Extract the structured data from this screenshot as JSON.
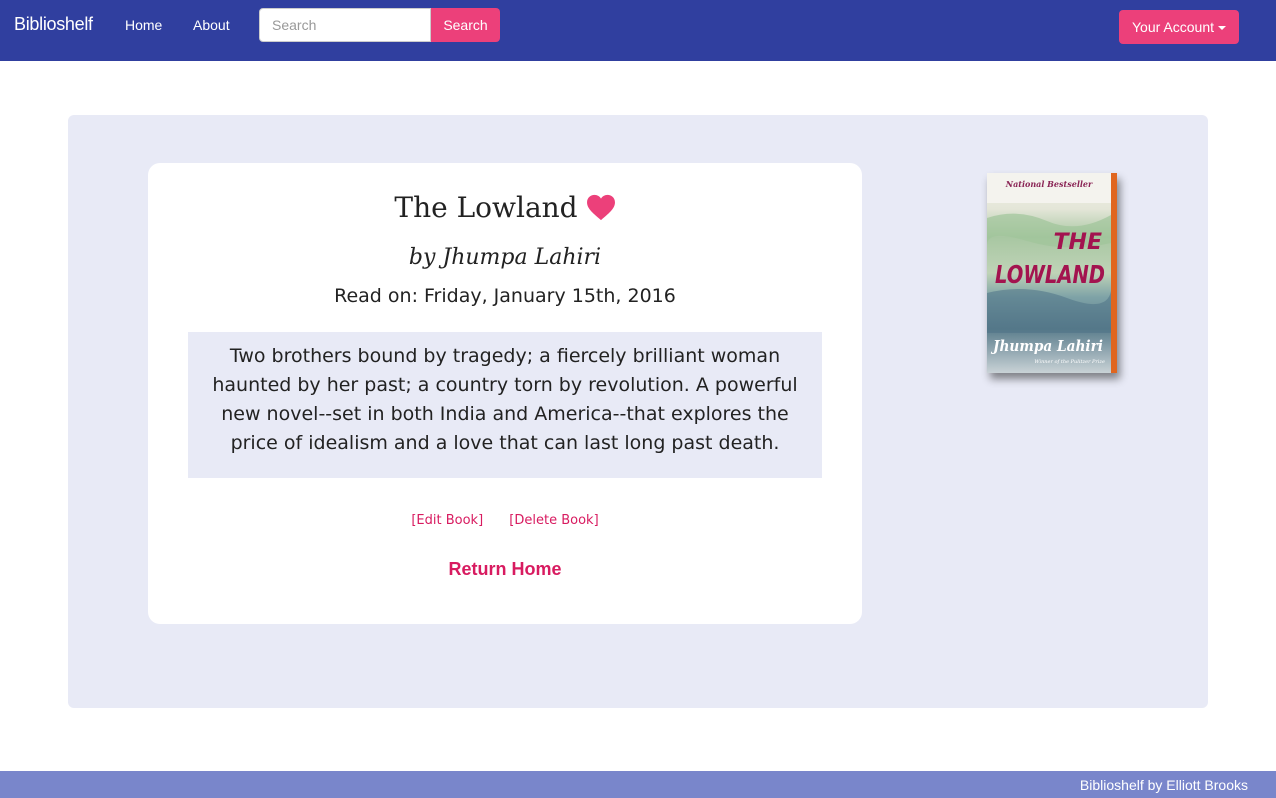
{
  "navbar": {
    "brand": "Biblioshelf",
    "links": [
      {
        "label": "Home"
      },
      {
        "label": "About"
      }
    ],
    "search": {
      "placeholder": "Search",
      "value": "",
      "button_label": "Search"
    },
    "account_label": "Your Account"
  },
  "book": {
    "title": "The Lowland",
    "favorite_icon": "heart-icon",
    "author_line": "by Jhumpa Lahiri",
    "read_on": "Read on: Friday, January 15th, 2016",
    "description": "Two brothers bound by tragedy; a fiercely brilliant woman haunted by her past; a country torn by revolution. A powerful new novel--set in both India and America--that explores the price of idealism and a love that can last long past death.",
    "edit_label": "[Edit Book]",
    "delete_label": "[Delete Book]",
    "return_label": "Return Home",
    "cover": {
      "top_text": "National Bestseller",
      "title_line1": "THE",
      "title_line2": "LOWLAND",
      "author": "Jhumpa Lahiri",
      "subtitle": "Winner of the Pulitzer Prize"
    }
  },
  "footer": {
    "text": "Biblioshelf by Elliott Brooks"
  },
  "colors": {
    "navbar": "#303f9f",
    "accent": "#ec407a",
    "link": "#d81b60",
    "jumbotron": "#e8eaf6",
    "footer": "#7986cb"
  }
}
